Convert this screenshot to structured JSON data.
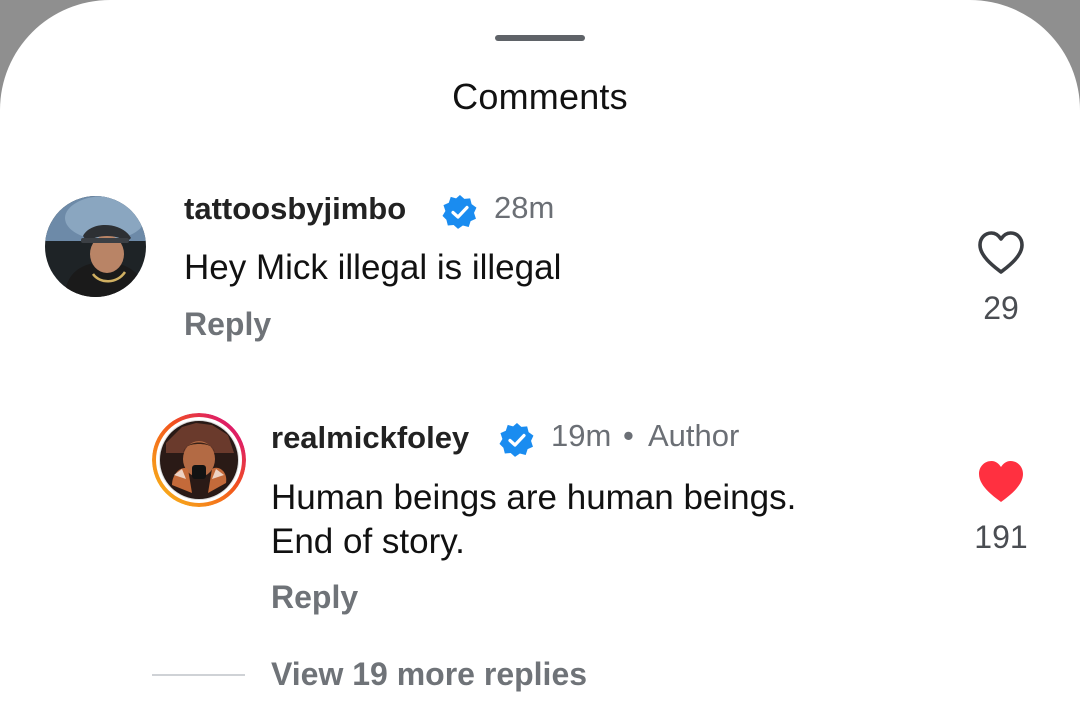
{
  "header": {
    "title": "Comments"
  },
  "comments": [
    {
      "username": "tattoosbyjimbo",
      "verified": true,
      "time": "28m",
      "text": "Hey Mick illegal is illegal",
      "reply_label": "Reply",
      "likes": "29",
      "liked": false,
      "avatar_icon": "profile-photo"
    }
  ],
  "replies": [
    {
      "username": "realmickfoley",
      "verified": true,
      "time": "19m",
      "separator": "•",
      "badge": "Author",
      "text_line1": "Human beings are human beings.",
      "text_line2": "End of story.",
      "reply_label": "Reply",
      "likes": "191",
      "liked": true,
      "avatar_icon": "story-ring-profile-photo"
    }
  ],
  "view_more": {
    "label": "View 19 more replies"
  },
  "colors": {
    "verified_blue": "#1a8cf0",
    "like_red": "#ff3040",
    "story_ring_start": "#f9c21a",
    "story_ring_end": "#d3008e"
  }
}
